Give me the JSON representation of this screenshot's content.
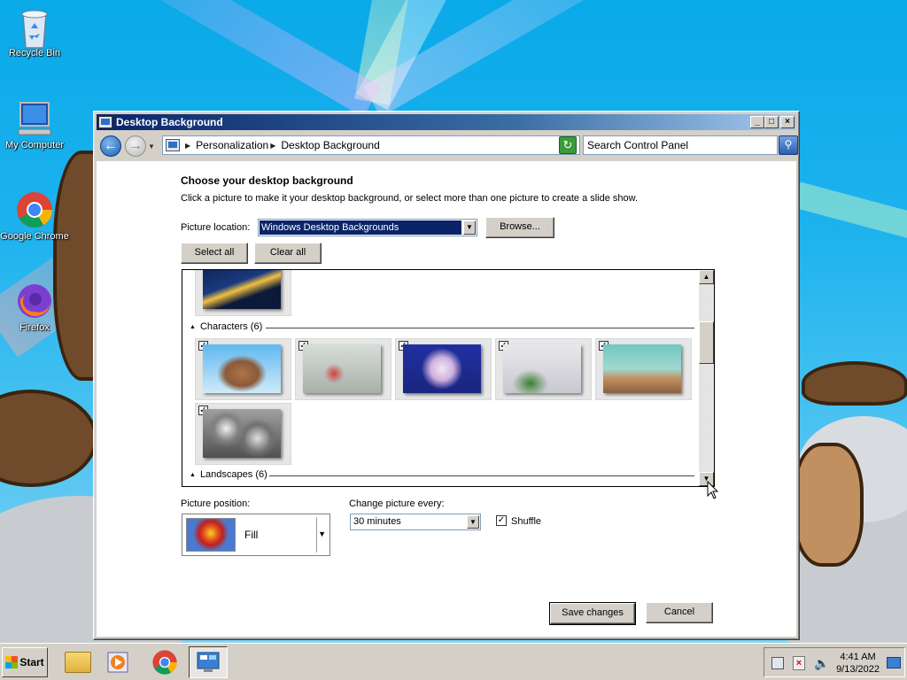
{
  "desktop": {
    "icons": [
      {
        "label": "Recycle Bin"
      },
      {
        "label": "My Computer"
      },
      {
        "label": "Google Chrome"
      },
      {
        "label": "Firefox"
      }
    ]
  },
  "window": {
    "title": "Desktop Background",
    "controls": {
      "minimize": "_",
      "maximize": "□",
      "close": "×"
    },
    "breadcrumb": [
      "Personalization",
      "Desktop Background"
    ],
    "search_placeholder": "Search Control Panel",
    "heading": "Choose your desktop background",
    "subheading": "Click a picture to make it your desktop background, or select more than one picture to create a slide show.",
    "picture_location_label": "Picture location:",
    "picture_location_value": "Windows Desktop Backgrounds",
    "browse_label": "Browse...",
    "select_all_label": "Select all",
    "clear_all_label": "Clear all",
    "gallery": {
      "groups": [
        {
          "name": "Characters (6)",
          "thumbnail_count": 6,
          "all_checked": true
        },
        {
          "name": "Landscapes (6)"
        }
      ]
    },
    "picture_position_label": "Picture position:",
    "picture_position_value": "Fill",
    "change_picture_label": "Change picture every:",
    "change_picture_value": "30 minutes",
    "shuffle_label": "Shuffle",
    "shuffle_checked": true,
    "save_label": "Save changes",
    "cancel_label": "Cancel"
  },
  "taskbar": {
    "start_label": "Start",
    "time": "4:41 AM",
    "date": "9/13/2022"
  }
}
